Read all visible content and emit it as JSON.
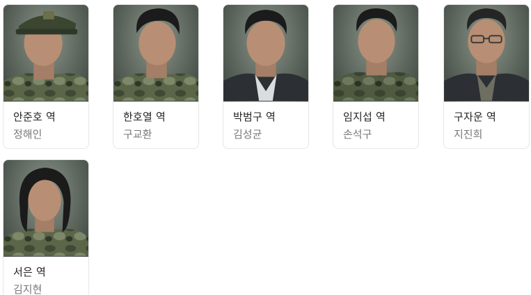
{
  "cast": [
    {
      "role": "안준호 역",
      "actor": "정해인"
    },
    {
      "role": "한호열 역",
      "actor": "구교환"
    },
    {
      "role": "박범구 역",
      "actor": "김성균"
    },
    {
      "role": "임지섭 역",
      "actor": "손석구"
    },
    {
      "role": "구자운 역",
      "actor": "지진희"
    },
    {
      "role": "서은 역",
      "actor": "김지현"
    }
  ],
  "colors": {
    "camo_dark": "#3f4a36",
    "camo_mid": "#5b6649",
    "camo_light": "#7d876a",
    "background": "#6f7a6e",
    "skin": "#b88f74",
    "hair": "#1b1b1b",
    "suit": "#2c2f33"
  },
  "icons": [
    "portrait-photo"
  ]
}
